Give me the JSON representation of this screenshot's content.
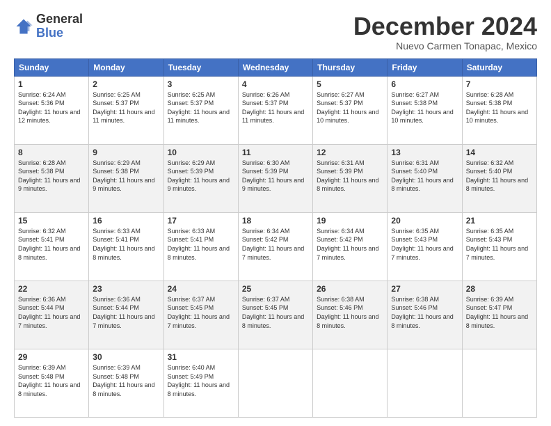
{
  "header": {
    "logo_general": "General",
    "logo_blue": "Blue",
    "month_title": "December 2024",
    "location": "Nuevo Carmen Tonapac, Mexico"
  },
  "weekdays": [
    "Sunday",
    "Monday",
    "Tuesday",
    "Wednesday",
    "Thursday",
    "Friday",
    "Saturday"
  ],
  "weeks": [
    [
      {
        "day": "1",
        "sunrise": "6:24 AM",
        "sunset": "5:36 PM",
        "daylight": "11 hours and 12 minutes."
      },
      {
        "day": "2",
        "sunrise": "6:25 AM",
        "sunset": "5:37 PM",
        "daylight": "11 hours and 11 minutes."
      },
      {
        "day": "3",
        "sunrise": "6:25 AM",
        "sunset": "5:37 PM",
        "daylight": "11 hours and 11 minutes."
      },
      {
        "day": "4",
        "sunrise": "6:26 AM",
        "sunset": "5:37 PM",
        "daylight": "11 hours and 11 minutes."
      },
      {
        "day": "5",
        "sunrise": "6:27 AM",
        "sunset": "5:37 PM",
        "daylight": "11 hours and 10 minutes."
      },
      {
        "day": "6",
        "sunrise": "6:27 AM",
        "sunset": "5:38 PM",
        "daylight": "11 hours and 10 minutes."
      },
      {
        "day": "7",
        "sunrise": "6:28 AM",
        "sunset": "5:38 PM",
        "daylight": "11 hours and 10 minutes."
      }
    ],
    [
      {
        "day": "8",
        "sunrise": "6:28 AM",
        "sunset": "5:38 PM",
        "daylight": "11 hours and 9 minutes."
      },
      {
        "day": "9",
        "sunrise": "6:29 AM",
        "sunset": "5:38 PM",
        "daylight": "11 hours and 9 minutes."
      },
      {
        "day": "10",
        "sunrise": "6:29 AM",
        "sunset": "5:39 PM",
        "daylight": "11 hours and 9 minutes."
      },
      {
        "day": "11",
        "sunrise": "6:30 AM",
        "sunset": "5:39 PM",
        "daylight": "11 hours and 9 minutes."
      },
      {
        "day": "12",
        "sunrise": "6:31 AM",
        "sunset": "5:39 PM",
        "daylight": "11 hours and 8 minutes."
      },
      {
        "day": "13",
        "sunrise": "6:31 AM",
        "sunset": "5:40 PM",
        "daylight": "11 hours and 8 minutes."
      },
      {
        "day": "14",
        "sunrise": "6:32 AM",
        "sunset": "5:40 PM",
        "daylight": "11 hours and 8 minutes."
      }
    ],
    [
      {
        "day": "15",
        "sunrise": "6:32 AM",
        "sunset": "5:41 PM",
        "daylight": "11 hours and 8 minutes."
      },
      {
        "day": "16",
        "sunrise": "6:33 AM",
        "sunset": "5:41 PM",
        "daylight": "11 hours and 8 minutes."
      },
      {
        "day": "17",
        "sunrise": "6:33 AM",
        "sunset": "5:41 PM",
        "daylight": "11 hours and 8 minutes."
      },
      {
        "day": "18",
        "sunrise": "6:34 AM",
        "sunset": "5:42 PM",
        "daylight": "11 hours and 7 minutes."
      },
      {
        "day": "19",
        "sunrise": "6:34 AM",
        "sunset": "5:42 PM",
        "daylight": "11 hours and 7 minutes."
      },
      {
        "day": "20",
        "sunrise": "6:35 AM",
        "sunset": "5:43 PM",
        "daylight": "11 hours and 7 minutes."
      },
      {
        "day": "21",
        "sunrise": "6:35 AM",
        "sunset": "5:43 PM",
        "daylight": "11 hours and 7 minutes."
      }
    ],
    [
      {
        "day": "22",
        "sunrise": "6:36 AM",
        "sunset": "5:44 PM",
        "daylight": "11 hours and 7 minutes."
      },
      {
        "day": "23",
        "sunrise": "6:36 AM",
        "sunset": "5:44 PM",
        "daylight": "11 hours and 7 minutes."
      },
      {
        "day": "24",
        "sunrise": "6:37 AM",
        "sunset": "5:45 PM",
        "daylight": "11 hours and 7 minutes."
      },
      {
        "day": "25",
        "sunrise": "6:37 AM",
        "sunset": "5:45 PM",
        "daylight": "11 hours and 8 minutes."
      },
      {
        "day": "26",
        "sunrise": "6:38 AM",
        "sunset": "5:46 PM",
        "daylight": "11 hours and 8 minutes."
      },
      {
        "day": "27",
        "sunrise": "6:38 AM",
        "sunset": "5:46 PM",
        "daylight": "11 hours and 8 minutes."
      },
      {
        "day": "28",
        "sunrise": "6:39 AM",
        "sunset": "5:47 PM",
        "daylight": "11 hours and 8 minutes."
      }
    ],
    [
      {
        "day": "29",
        "sunrise": "6:39 AM",
        "sunset": "5:48 PM",
        "daylight": "11 hours and 8 minutes."
      },
      {
        "day": "30",
        "sunrise": "6:39 AM",
        "sunset": "5:48 PM",
        "daylight": "11 hours and 8 minutes."
      },
      {
        "day": "31",
        "sunrise": "6:40 AM",
        "sunset": "5:49 PM",
        "daylight": "11 hours and 8 minutes."
      },
      null,
      null,
      null,
      null
    ]
  ]
}
